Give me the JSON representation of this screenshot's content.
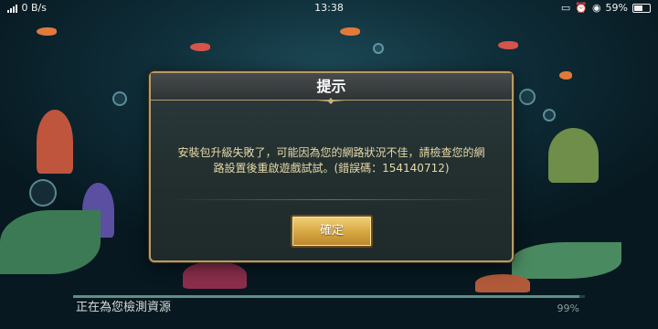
{
  "status_bar": {
    "network_speed": "0 B/s",
    "time": "13:38",
    "battery": "59%",
    "battery_level": 0.59
  },
  "dialog": {
    "title": "提示",
    "message_line1": "安裝包升級失敗了，可能因為您的網路狀況不佳，請檢查您的網",
    "message_line2": "路設置後重啟遊戲試試。(錯誤碼：154140712)",
    "confirm_label": "確定"
  },
  "loading": {
    "label": "正在為您檢測資源",
    "percent": "99%",
    "progress": 0.99
  }
}
